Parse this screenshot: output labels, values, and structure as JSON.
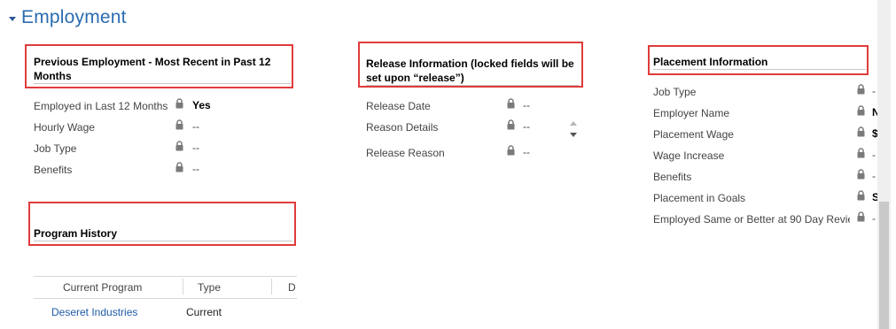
{
  "section": {
    "title": "Employment"
  },
  "previous_employment": {
    "title_line1": "Previous Employment - Most Recent in Past 12",
    "title_line2": "Months",
    "fields": [
      {
        "label": "Employed in Last 12 Months",
        "value": "Yes"
      },
      {
        "label": "Hourly Wage",
        "value": "--"
      },
      {
        "label": "Job Type",
        "value": "--"
      },
      {
        "label": "Benefits",
        "value": "--"
      }
    ]
  },
  "release_information": {
    "title_line1": "Release Information (locked fields will be",
    "title_line2": "set upon “release”)",
    "fields": [
      {
        "label": "Release Date",
        "value": "--"
      },
      {
        "label": "Reason Details",
        "value": "--"
      },
      {
        "label": "Release Reason",
        "value": "--"
      }
    ]
  },
  "placement_information": {
    "title": "Placement Information",
    "fields": [
      {
        "label": "Job Type",
        "value": "-"
      },
      {
        "label": "Employer Name",
        "value": "N"
      },
      {
        "label": "Placement Wage",
        "value": "$"
      },
      {
        "label": "Wage Increase",
        "value": "-"
      },
      {
        "label": "Benefits",
        "value": "-"
      },
      {
        "label": "Placement in Goals",
        "value": "S"
      },
      {
        "label": "Employed Same or Better at 90 Day Revie",
        "value": "-"
      }
    ]
  },
  "program_history": {
    "title": "Program History",
    "columns": [
      "Current Program",
      "Type",
      "D"
    ],
    "rows": [
      {
        "program": "Deseret Industries",
        "type": "Current"
      }
    ]
  },
  "icons": {
    "lock": "lock-icon",
    "collapse": "collapse-triangle-icon"
  },
  "colors": {
    "title": "#2b6cb0",
    "highlight": "#e03b3b",
    "link": "#1e5aa8"
  }
}
